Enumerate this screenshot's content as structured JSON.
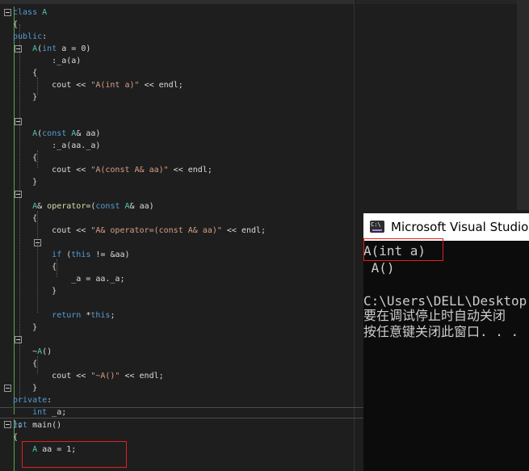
{
  "editor": {
    "lines": [
      {
        "parts": [
          [
            "kw",
            "class "
          ],
          [
            "ty",
            "A"
          ]
        ]
      },
      {
        "parts": [
          [
            "",
            "{"
          ]
        ]
      },
      {
        "parts": [
          [
            "kw",
            "public"
          ],
          [
            "",
            ":"
          ]
        ]
      },
      {
        "parts": [
          [
            "",
            "    "
          ],
          [
            "ty",
            "A"
          ],
          [
            "",
            "("
          ],
          [
            "kw",
            "int"
          ],
          [
            "",
            " a = 0)"
          ]
        ]
      },
      {
        "parts": [
          [
            "",
            "        :_a(a)"
          ]
        ]
      },
      {
        "parts": [
          [
            "",
            "    {"
          ]
        ]
      },
      {
        "parts": [
          [
            "",
            "        cout << "
          ],
          [
            "str",
            "\"A(int a)\""
          ],
          [
            "",
            " << endl;"
          ]
        ]
      },
      {
        "parts": [
          [
            "",
            "    }"
          ]
        ]
      },
      {
        "parts": [
          [
            "",
            ""
          ]
        ]
      },
      {
        "parts": [
          [
            "",
            ""
          ]
        ]
      },
      {
        "parts": [
          [
            "",
            "    "
          ],
          [
            "ty",
            "A"
          ],
          [
            "",
            "("
          ],
          [
            "kw",
            "const"
          ],
          [
            "ty",
            " A"
          ],
          [
            "",
            "& aa)"
          ]
        ]
      },
      {
        "parts": [
          [
            "",
            "        :_a(aa._a)"
          ]
        ]
      },
      {
        "parts": [
          [
            "",
            "    {"
          ]
        ]
      },
      {
        "parts": [
          [
            "",
            "        cout << "
          ],
          [
            "str",
            "\"A(const A& aa)\""
          ],
          [
            "",
            " << endl;"
          ]
        ]
      },
      {
        "parts": [
          [
            "",
            "    }"
          ]
        ]
      },
      {
        "parts": [
          [
            "",
            ""
          ]
        ]
      },
      {
        "parts": [
          [
            "",
            "    "
          ],
          [
            "ty",
            "A"
          ],
          [
            "",
            "& "
          ],
          [
            "fn",
            "operator="
          ],
          [
            "",
            "("
          ],
          [
            "kw",
            "const"
          ],
          [
            "ty",
            " A"
          ],
          [
            "",
            "& aa)"
          ]
        ]
      },
      {
        "parts": [
          [
            "",
            "    {"
          ]
        ]
      },
      {
        "parts": [
          [
            "",
            "        cout << "
          ],
          [
            "str",
            "\"A& operator=(const A& aa)\""
          ],
          [
            "",
            " << endl;"
          ]
        ]
      },
      {
        "parts": [
          [
            "",
            ""
          ]
        ]
      },
      {
        "parts": [
          [
            "",
            "        "
          ],
          [
            "kw",
            "if"
          ],
          [
            "",
            " ("
          ],
          [
            "kw",
            "this"
          ],
          [
            "",
            " != &aa)"
          ]
        ]
      },
      {
        "parts": [
          [
            "",
            "        {"
          ]
        ]
      },
      {
        "parts": [
          [
            "",
            "            _a = aa._a;"
          ]
        ]
      },
      {
        "parts": [
          [
            "",
            "        }"
          ]
        ]
      },
      {
        "parts": [
          [
            "",
            ""
          ]
        ]
      },
      {
        "parts": [
          [
            "",
            "        "
          ],
          [
            "kw",
            "return"
          ],
          [
            "",
            " *"
          ],
          [
            "kw",
            "this"
          ],
          [
            "",
            ";"
          ]
        ]
      },
      {
        "parts": [
          [
            "",
            "    }"
          ]
        ]
      },
      {
        "parts": [
          [
            "",
            ""
          ]
        ]
      },
      {
        "parts": [
          [
            "",
            "    ~"
          ],
          [
            "ty",
            "A"
          ],
          [
            "",
            "()"
          ]
        ]
      },
      {
        "parts": [
          [
            "",
            "    {"
          ]
        ]
      },
      {
        "parts": [
          [
            "",
            "        cout << "
          ],
          [
            "str",
            "\"~A()\""
          ],
          [
            "",
            " << endl;"
          ]
        ]
      },
      {
        "parts": [
          [
            "",
            "    }"
          ]
        ]
      },
      {
        "parts": [
          [
            "kw",
            "private"
          ],
          [
            "",
            ":"
          ]
        ]
      },
      {
        "parts": [
          [
            "",
            "    "
          ],
          [
            "kw",
            "int"
          ],
          [
            "",
            " _a;"
          ]
        ]
      },
      {
        "parts": [
          [
            "",
            "};"
          ]
        ]
      },
      {
        "parts": [
          [
            "kw",
            "int"
          ],
          [
            "",
            " main()"
          ]
        ]
      },
      {
        "parts": [
          [
            "",
            "{"
          ]
        ]
      },
      {
        "parts": [
          [
            "",
            "    "
          ],
          [
            "ty",
            "A"
          ],
          [
            "",
            " aa = 1;"
          ]
        ]
      }
    ]
  },
  "console": {
    "title": "Microsoft Visual Studio",
    "lines": [
      "A(int a)",
      " A()",
      "",
      "C:\\Users\\DELL\\Desktop",
      "要在调试停止时自动关闭",
      "按任意键关闭此窗口. . ."
    ]
  },
  "colors": {
    "editor_bg": "#1e1e1e",
    "keyword": "#569cd6",
    "type": "#4ec9b0",
    "string": "#d69d85",
    "highlight_box": "#e02020"
  }
}
